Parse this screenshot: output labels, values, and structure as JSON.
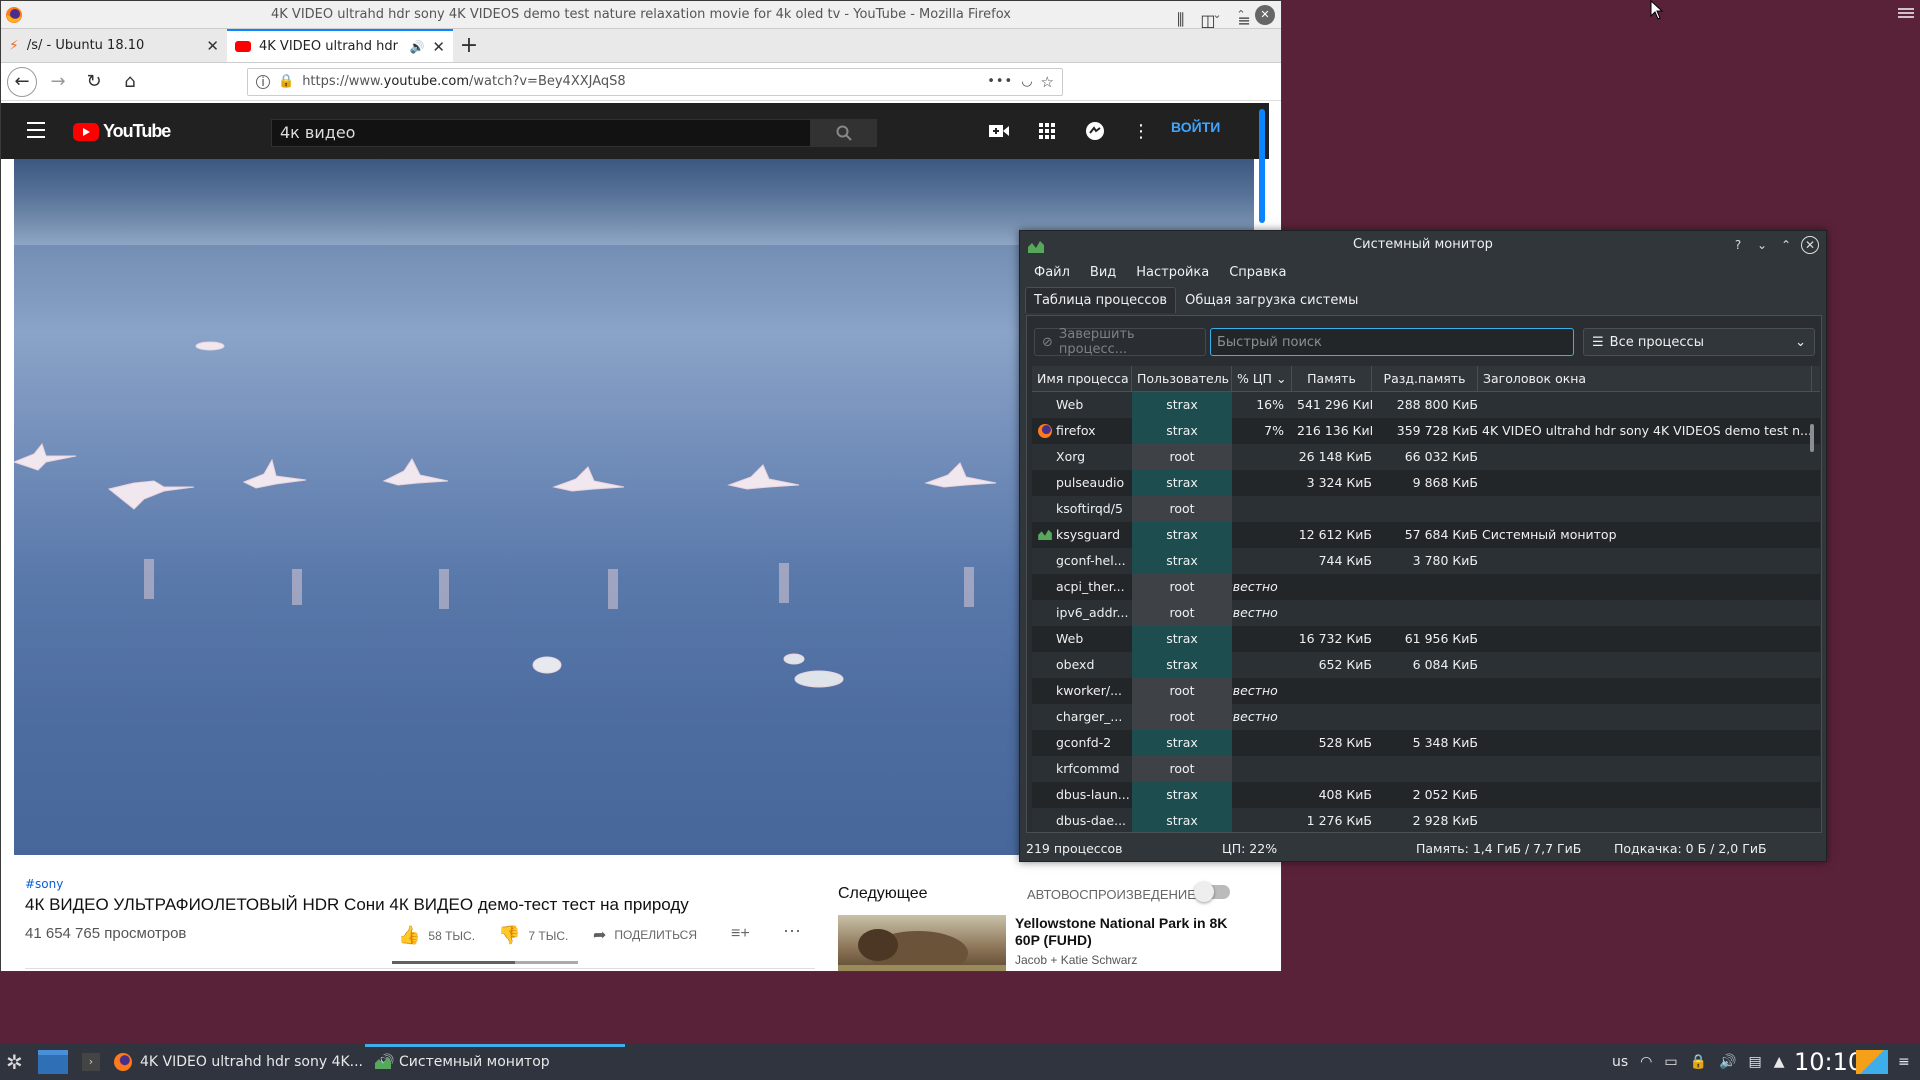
{
  "firefox": {
    "window_title": "4K VIDEO ultrahd hdr sony 4K VIDEOS demo test nature relaxation movie for 4k oled tv - YouTube - Mozilla Firefox",
    "tabs": [
      {
        "label": "/s/ - Ubuntu 18.10"
      },
      {
        "label": "4K VIDEO ultrahd hdr sony"
      }
    ],
    "url_prefix": "https://www.",
    "url_domain": "youtube.com",
    "url_rest": "/watch?v=Bey4XXJAqS8"
  },
  "youtube": {
    "search_value": "4к видео",
    "login_label": "ВОЙТИ",
    "video_tag": "#sony",
    "video_title": "4К ВИДЕО УЛЬТРАФИОЛЕТОВЫЙ HDR Сони 4К ВИДЕО демо-тест тест на природу",
    "views": "41 654 765 просмотров",
    "likes": "58 ТЫС.",
    "like_ratio": 0.66,
    "dislikes": "7 ТЫС.",
    "share_label": "ПОДЕЛИТЬСЯ",
    "next_heading": "Следующее",
    "autoplay_label": "АВТОВОСПРОИЗВЕДЕНИЕ",
    "rec_title": "Yellowstone National Park in 8K 60P (FUHD)",
    "rec_channel": "Jacob + Katie Schwarz"
  },
  "sysmon": {
    "title": "Системный монитор",
    "menu": [
      "Файл",
      "Вид",
      "Настройка",
      "Справка"
    ],
    "tabs": [
      "Таблица процессов",
      "Общая загрузка системы"
    ],
    "kill_label": "Завершить процесс...",
    "search_placeholder": "Быстрый поиск",
    "filter_value": "Все процессы",
    "columns": [
      "Имя процесса",
      "Пользователь",
      "% ЦП",
      "Память",
      "Разд.память",
      "Заголовок окна"
    ],
    "rows": [
      {
        "name": "Web",
        "user": "strax",
        "cpu": "16%",
        "mem": "541 296 КиБ",
        "shared": "288 800 КиБ",
        "win": "",
        "icon": ""
      },
      {
        "name": "firefox",
        "user": "strax",
        "cpu": "7%",
        "mem": "216 136 КиБ",
        "shared": "359 728 КиБ",
        "win": "4K VIDEO ultrahd hdr sony 4K VIDEOS demo test n...",
        "icon": "firefox-icon"
      },
      {
        "name": "Xorg",
        "user": "root",
        "cpu": "",
        "mem": "26 148 КиБ",
        "shared": "66 032 КиБ",
        "win": "",
        "icon": ""
      },
      {
        "name": "pulseaudio",
        "user": "strax",
        "cpu": "",
        "mem": "3 324 КиБ",
        "shared": "9 868 КиБ",
        "win": "",
        "icon": ""
      },
      {
        "name": "ksoftirqd/5",
        "user": "root",
        "cpu": "",
        "mem": "",
        "shared": "",
        "win": "",
        "icon": ""
      },
      {
        "name": "ksysguard",
        "user": "strax",
        "cpu": "",
        "mem": "12 612 КиБ",
        "shared": "57 684 КиБ",
        "win": "Системный монитор",
        "icon": "ksysguard-icon"
      },
      {
        "name": "gconf-hel...",
        "user": "strax",
        "cpu": "",
        "mem": "744 КиБ",
        "shared": "3 780 КиБ",
        "win": "",
        "icon": ""
      },
      {
        "name": "acpi_ther...",
        "user": "root",
        "cpu": "",
        "mem": "",
        "shared": "",
        "win": "",
        "icon": "",
        "unknown": "известно"
      },
      {
        "name": "ipv6_addr...",
        "user": "root",
        "cpu": "",
        "mem": "",
        "shared": "",
        "win": "",
        "icon": "",
        "unknown": "известно"
      },
      {
        "name": "Web",
        "user": "strax",
        "cpu": "",
        "mem": "16 732 КиБ",
        "shared": "61 956 КиБ",
        "win": "",
        "icon": ""
      },
      {
        "name": "obexd",
        "user": "strax",
        "cpu": "",
        "mem": "652 КиБ",
        "shared": "6 084 КиБ",
        "win": "",
        "icon": ""
      },
      {
        "name": "kworker/...",
        "user": "root",
        "cpu": "",
        "mem": "",
        "shared": "",
        "win": "",
        "icon": "",
        "unknown": "известно"
      },
      {
        "name": "charger_...",
        "user": "root",
        "cpu": "",
        "mem": "",
        "shared": "",
        "win": "",
        "icon": "",
        "unknown": "известно"
      },
      {
        "name": "gconfd-2",
        "user": "strax",
        "cpu": "",
        "mem": "528 КиБ",
        "shared": "5 348 КиБ",
        "win": "",
        "icon": ""
      },
      {
        "name": "krfcommd",
        "user": "root",
        "cpu": "",
        "mem": "",
        "shared": "",
        "win": "",
        "icon": ""
      },
      {
        "name": "dbus-laun...",
        "user": "strax",
        "cpu": "",
        "mem": "408 КиБ",
        "shared": "2 052 КиБ",
        "win": "",
        "icon": ""
      },
      {
        "name": "dbus-dae...",
        "user": "strax",
        "cpu": "",
        "mem": "1 276 КиБ",
        "shared": "2 928 КиБ",
        "win": "",
        "icon": ""
      }
    ],
    "status": {
      "count": "219 процессов",
      "cpu": "ЦП: 22%",
      "mem": "Память: 1,4 ГиБ / 7,7 ГиБ",
      "swap": "Подкачка: 0 Б / 2,0 ГиБ"
    }
  },
  "taskbar": {
    "items": [
      {
        "label": "4K VIDEO ultrahd hdr sony 4K..."
      },
      {
        "label": "Системный монитор"
      }
    ],
    "keyboard_layout": "us",
    "clock": "10:10"
  },
  "colors": {
    "desktop": "#5a2238",
    "youtube_red": "#ff0000",
    "kde_accent": "#3daee9",
    "strax_cell": "#1e4d4f"
  }
}
